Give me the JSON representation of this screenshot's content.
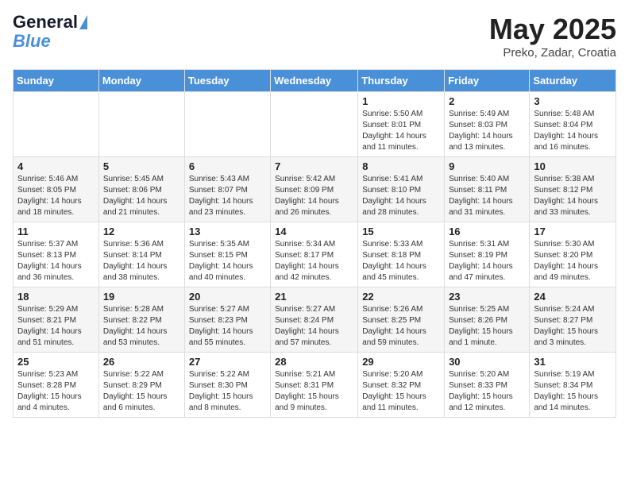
{
  "header": {
    "logo_line1": "General",
    "logo_line2": "Blue",
    "title": "May 2025",
    "location": "Preko, Zadar, Croatia"
  },
  "weekdays": [
    "Sunday",
    "Monday",
    "Tuesday",
    "Wednesday",
    "Thursday",
    "Friday",
    "Saturday"
  ],
  "weeks": [
    [
      {
        "day": "",
        "info": ""
      },
      {
        "day": "",
        "info": ""
      },
      {
        "day": "",
        "info": ""
      },
      {
        "day": "",
        "info": ""
      },
      {
        "day": "1",
        "info": "Sunrise: 5:50 AM\nSunset: 8:01 PM\nDaylight: 14 hours and 11 minutes."
      },
      {
        "day": "2",
        "info": "Sunrise: 5:49 AM\nSunset: 8:03 PM\nDaylight: 14 hours and 13 minutes."
      },
      {
        "day": "3",
        "info": "Sunrise: 5:48 AM\nSunset: 8:04 PM\nDaylight: 14 hours and 16 minutes."
      }
    ],
    [
      {
        "day": "4",
        "info": "Sunrise: 5:46 AM\nSunset: 8:05 PM\nDaylight: 14 hours and 18 minutes."
      },
      {
        "day": "5",
        "info": "Sunrise: 5:45 AM\nSunset: 8:06 PM\nDaylight: 14 hours and 21 minutes."
      },
      {
        "day": "6",
        "info": "Sunrise: 5:43 AM\nSunset: 8:07 PM\nDaylight: 14 hours and 23 minutes."
      },
      {
        "day": "7",
        "info": "Sunrise: 5:42 AM\nSunset: 8:09 PM\nDaylight: 14 hours and 26 minutes."
      },
      {
        "day": "8",
        "info": "Sunrise: 5:41 AM\nSunset: 8:10 PM\nDaylight: 14 hours and 28 minutes."
      },
      {
        "day": "9",
        "info": "Sunrise: 5:40 AM\nSunset: 8:11 PM\nDaylight: 14 hours and 31 minutes."
      },
      {
        "day": "10",
        "info": "Sunrise: 5:38 AM\nSunset: 8:12 PM\nDaylight: 14 hours and 33 minutes."
      }
    ],
    [
      {
        "day": "11",
        "info": "Sunrise: 5:37 AM\nSunset: 8:13 PM\nDaylight: 14 hours and 36 minutes."
      },
      {
        "day": "12",
        "info": "Sunrise: 5:36 AM\nSunset: 8:14 PM\nDaylight: 14 hours and 38 minutes."
      },
      {
        "day": "13",
        "info": "Sunrise: 5:35 AM\nSunset: 8:15 PM\nDaylight: 14 hours and 40 minutes."
      },
      {
        "day": "14",
        "info": "Sunrise: 5:34 AM\nSunset: 8:17 PM\nDaylight: 14 hours and 42 minutes."
      },
      {
        "day": "15",
        "info": "Sunrise: 5:33 AM\nSunset: 8:18 PM\nDaylight: 14 hours and 45 minutes."
      },
      {
        "day": "16",
        "info": "Sunrise: 5:31 AM\nSunset: 8:19 PM\nDaylight: 14 hours and 47 minutes."
      },
      {
        "day": "17",
        "info": "Sunrise: 5:30 AM\nSunset: 8:20 PM\nDaylight: 14 hours and 49 minutes."
      }
    ],
    [
      {
        "day": "18",
        "info": "Sunrise: 5:29 AM\nSunset: 8:21 PM\nDaylight: 14 hours and 51 minutes."
      },
      {
        "day": "19",
        "info": "Sunrise: 5:28 AM\nSunset: 8:22 PM\nDaylight: 14 hours and 53 minutes."
      },
      {
        "day": "20",
        "info": "Sunrise: 5:27 AM\nSunset: 8:23 PM\nDaylight: 14 hours and 55 minutes."
      },
      {
        "day": "21",
        "info": "Sunrise: 5:27 AM\nSunset: 8:24 PM\nDaylight: 14 hours and 57 minutes."
      },
      {
        "day": "22",
        "info": "Sunrise: 5:26 AM\nSunset: 8:25 PM\nDaylight: 14 hours and 59 minutes."
      },
      {
        "day": "23",
        "info": "Sunrise: 5:25 AM\nSunset: 8:26 PM\nDaylight: 15 hours and 1 minute."
      },
      {
        "day": "24",
        "info": "Sunrise: 5:24 AM\nSunset: 8:27 PM\nDaylight: 15 hours and 3 minutes."
      }
    ],
    [
      {
        "day": "25",
        "info": "Sunrise: 5:23 AM\nSunset: 8:28 PM\nDaylight: 15 hours and 4 minutes."
      },
      {
        "day": "26",
        "info": "Sunrise: 5:22 AM\nSunset: 8:29 PM\nDaylight: 15 hours and 6 minutes."
      },
      {
        "day": "27",
        "info": "Sunrise: 5:22 AM\nSunset: 8:30 PM\nDaylight: 15 hours and 8 minutes."
      },
      {
        "day": "28",
        "info": "Sunrise: 5:21 AM\nSunset: 8:31 PM\nDaylight: 15 hours and 9 minutes."
      },
      {
        "day": "29",
        "info": "Sunrise: 5:20 AM\nSunset: 8:32 PM\nDaylight: 15 hours and 11 minutes."
      },
      {
        "day": "30",
        "info": "Sunrise: 5:20 AM\nSunset: 8:33 PM\nDaylight: 15 hours and 12 minutes."
      },
      {
        "day": "31",
        "info": "Sunrise: 5:19 AM\nSunset: 8:34 PM\nDaylight: 15 hours and 14 minutes."
      }
    ]
  ]
}
